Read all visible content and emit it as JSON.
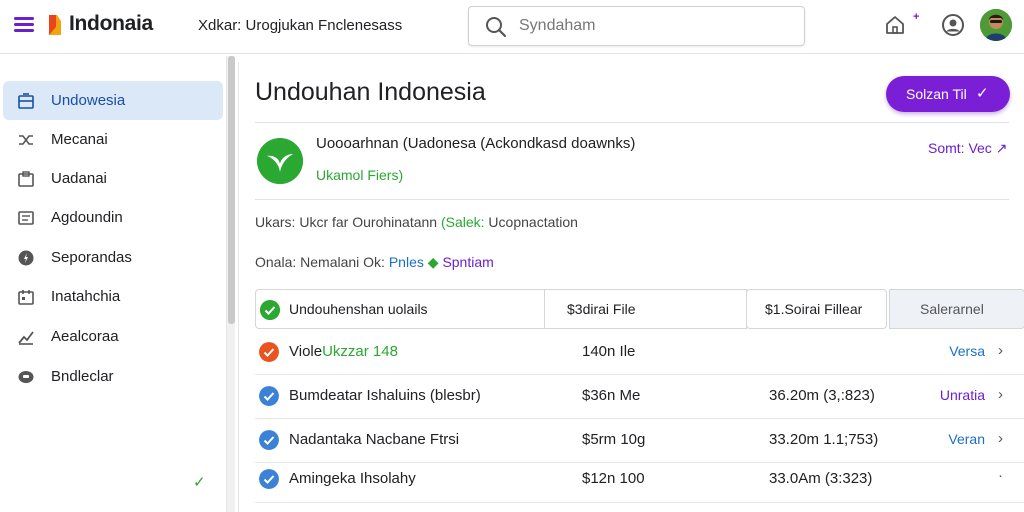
{
  "header": {
    "app_name": "Indonaia",
    "breadcrumb": "Xdkar: Urogjukan Fnclenesass",
    "search_placeholder": "Syndaham",
    "plus_badge": "+",
    "brand_color": "#6a1fd0"
  },
  "sidebar": {
    "items": [
      {
        "label": "Undowesia",
        "icon": "inbox-icon",
        "active": true
      },
      {
        "label": "Mecanai",
        "icon": "shuffle-icon",
        "active": false
      },
      {
        "label": "Uadanai",
        "icon": "folder-icon",
        "active": false
      },
      {
        "label": "Agdoundin",
        "icon": "list-icon",
        "active": false
      },
      {
        "label": "Seporandas",
        "icon": "compass-icon",
        "active": false
      },
      {
        "label": "Inatahchia",
        "icon": "calendar-icon",
        "active": false
      },
      {
        "label": "Aealcoraa",
        "icon": "chart-icon",
        "active": false
      },
      {
        "label": "Bndleclar",
        "icon": "archive-icon",
        "active": false
      }
    ]
  },
  "main": {
    "title": "Undouhan Indonesia",
    "primary_button": "Solzan Til",
    "file": {
      "name": "Uoooarhnan (Uadonesa (Ackondkasd doawnks)",
      "subtitle": "Ukamol Fiers)",
      "side_link": "Somt: Vec"
    },
    "meta_line1": {
      "prefix": "Ukars:  Ukcr far Ourohinatann",
      "green": "(Salek:",
      "suffix": " Ucopnactation"
    },
    "meta_line2": {
      "prefix": "Onala: Nemalani Ok:",
      "blue": "Pnles",
      "purple": "Spntiam"
    },
    "table": {
      "headers": [
        "Undouhenshan uolails",
        "$3dirai File",
        "$1.Soirai Fillear",
        "Salerarnel"
      ],
      "rows": [
        {
          "name": "Viole",
          "name_tag": "Ukzzar 148",
          "size": "140n Ile",
          "date": "",
          "action": "Versa",
          "color": "#e8531f",
          "action_color": "#1a6fc9"
        },
        {
          "name": "Bumdeatar Ishaluins (blesbr)",
          "name_tag": "",
          "size": "$36n Me",
          "date": "36.20m (3,:823)",
          "action": "Unratia",
          "color": "#3b82d6",
          "action_color": "#6a1fd0"
        },
        {
          "name": "Nadantaka Nacbane Ftrsi",
          "name_tag": "",
          "size": "$5rm 10g",
          "date": "33.20m 1.1;753)",
          "action": "Veran",
          "color": "#3b82d6",
          "action_color": "#1a6fc9"
        },
        {
          "name": "Amingeka Ihsolahy",
          "name_tag": "",
          "size": "$12n 100",
          "date": "33.0Am (3:323)",
          "action": "",
          "color": "#3b82d6",
          "action_color": "#1a6fc9"
        }
      ]
    }
  }
}
